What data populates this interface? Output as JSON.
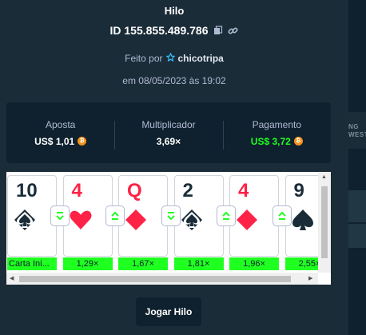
{
  "modal": {
    "title": "Hilo",
    "game_id": "ID 155.855.489.786",
    "made_by_label": "Feito por",
    "username": "chicotripa",
    "date": "em 08/05/2023 às 19:02"
  },
  "stats": {
    "bet_label": "Aposta",
    "bet_value": "US$ 1,01",
    "multiplier_label": "Multiplicador",
    "multiplier_value": "3,69×",
    "payout_label": "Pagamento",
    "payout_value": "US$ 3,72",
    "coin_symbol": "₿"
  },
  "cards": [
    {
      "rank": "10",
      "suit": "spade-diamond",
      "color": "black",
      "multiplier": "Carta Ini..."
    },
    {
      "rank": "4",
      "suit": "heart",
      "color": "red",
      "multiplier": "1,29×",
      "guess": "lower"
    },
    {
      "rank": "Q",
      "suit": "diamond",
      "color": "red",
      "multiplier": "1,67×",
      "guess": "higher"
    },
    {
      "rank": "2",
      "suit": "spade-diamond",
      "color": "black",
      "multiplier": "1,81×",
      "guess": "lower"
    },
    {
      "rank": "4",
      "suit": "diamond",
      "color": "red",
      "multiplier": "1,96×",
      "guess": "higher"
    },
    {
      "rank": "9",
      "suit": "spade",
      "color": "black",
      "multiplier": "2,55×",
      "guess": "higher"
    }
  ],
  "side_panel": {
    "text_line1": "NG",
    "text_line2": "WEST"
  },
  "actions": {
    "play_button": "Jogar Hilo"
  },
  "colors": {
    "background": "#1a2c38",
    "panel": "#0f212e",
    "win_green": "#1fff20",
    "card_red": "#fe2247",
    "card_black": "#1a2c38"
  }
}
